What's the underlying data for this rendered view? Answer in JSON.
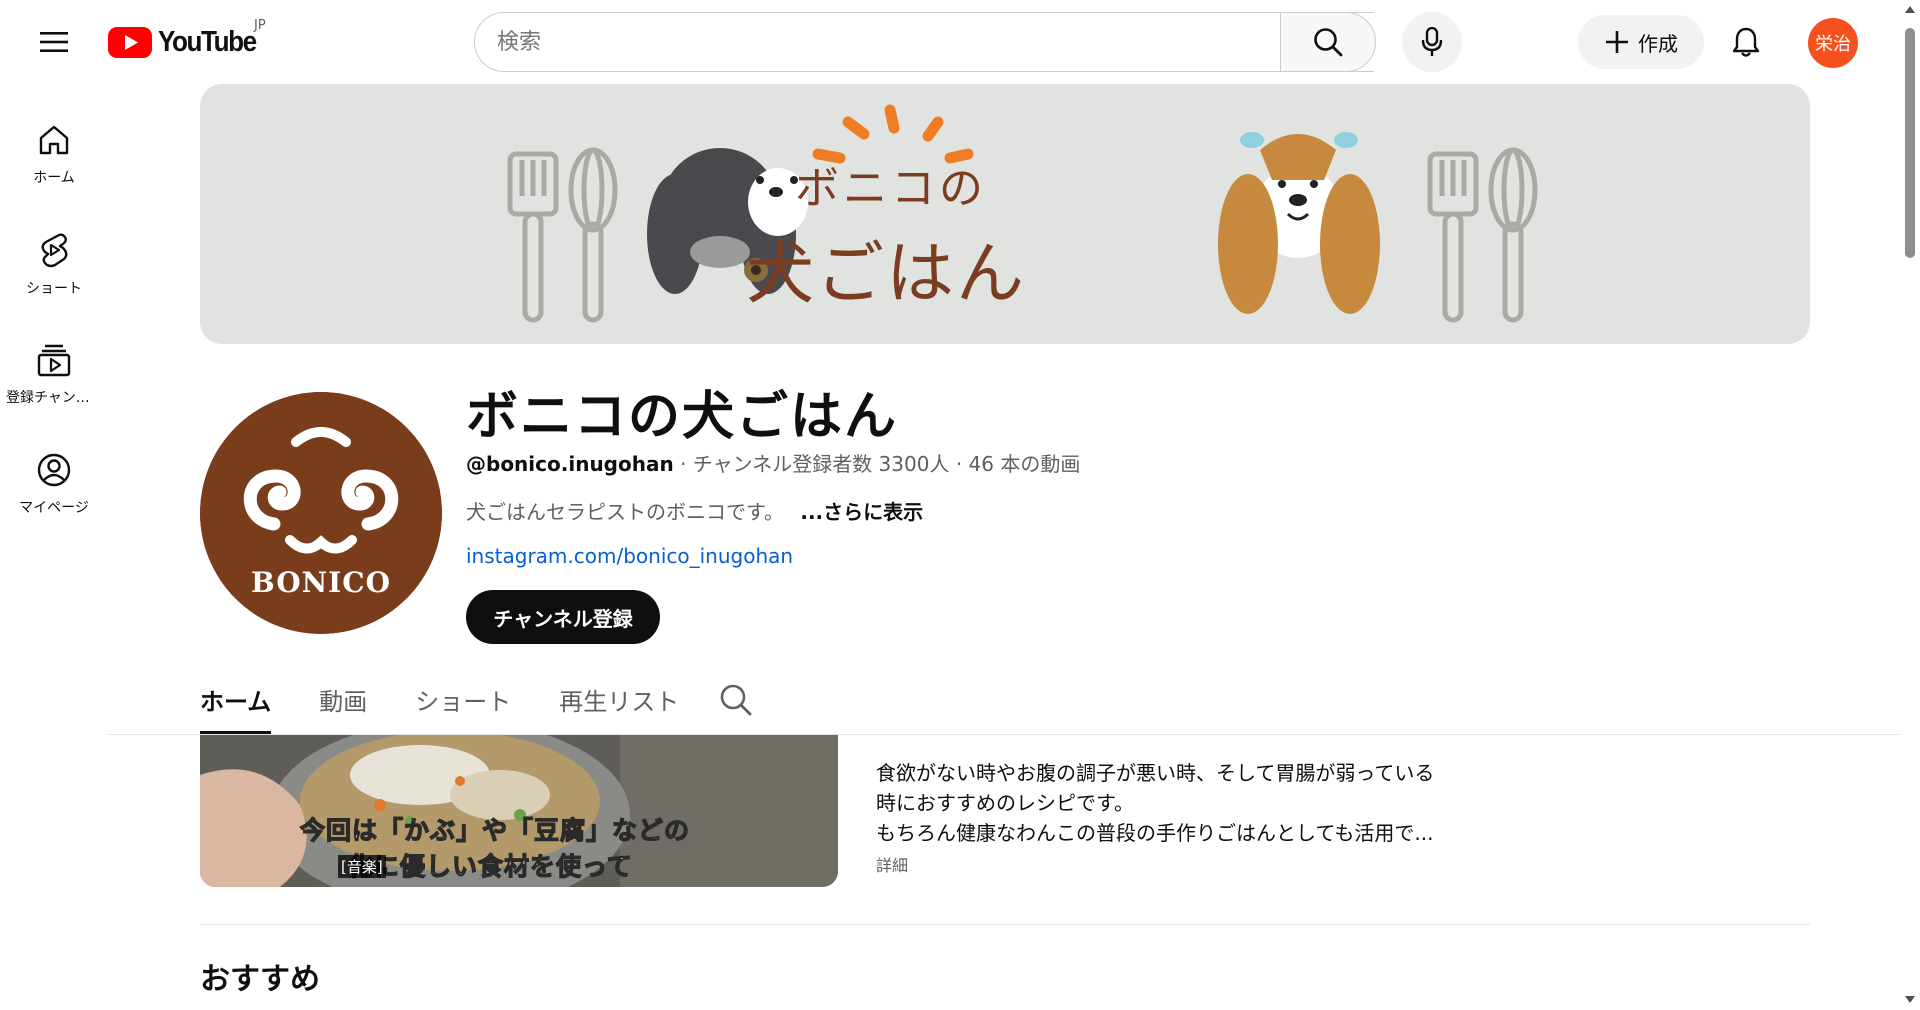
{
  "header": {
    "logo_text": "YouTube",
    "country_code": "JP",
    "search_placeholder": "検索",
    "create_label": "作成",
    "avatar_text": "栄治",
    "avatar_color": "#f4511e"
  },
  "sidebar": {
    "items": [
      {
        "label": "ホーム",
        "icon": "home-icon"
      },
      {
        "label": "ショート",
        "icon": "shorts-icon"
      },
      {
        "label": "登録チャンネル",
        "icon": "subscriptions-icon"
      },
      {
        "label": "マイページ",
        "icon": "account-icon"
      }
    ]
  },
  "banner": {
    "title_line1": "ボニコの",
    "title_line2": "犬ごはん"
  },
  "channel": {
    "avatar_text": "BONICO",
    "name": "ボニコの犬ごはん",
    "handle": "@bonico.inugohan",
    "subscribers": "チャンネル登録者数 3300人",
    "video_count": "46 本の動画",
    "description": "犬ごはんセラピストのボニコです。",
    "more_label": "...さらに表示",
    "link": "instagram.com/bonico_inugohan",
    "subscribe_label": "チャンネル登録"
  },
  "tabs": [
    {
      "label": "ホーム",
      "active": true
    },
    {
      "label": "動画",
      "active": false
    },
    {
      "label": "ショート",
      "active": false
    },
    {
      "label": "再生リスト",
      "active": false
    }
  ],
  "featured": {
    "caption_line1": "今回は「かぶ」や「豆腐」などの",
    "caption_line2": "化に優しい食材を使って",
    "caption_tag": "[音楽]",
    "desc_lines": [
      "食欲がない時やお腹の調子が悪い時、そして胃腸が弱っている",
      "時におすすめのレシピです。",
      "もちろん健康なわんこの普段の手作りごはんとしても活用で..."
    ],
    "detail_label": "詳細"
  },
  "section": {
    "title": "おすすめ"
  },
  "colors": {
    "link": "#065fd4",
    "brand_red": "#ff0000",
    "banner_bg": "#e1e3e0",
    "avatar_brown": "#7a3d1c"
  }
}
